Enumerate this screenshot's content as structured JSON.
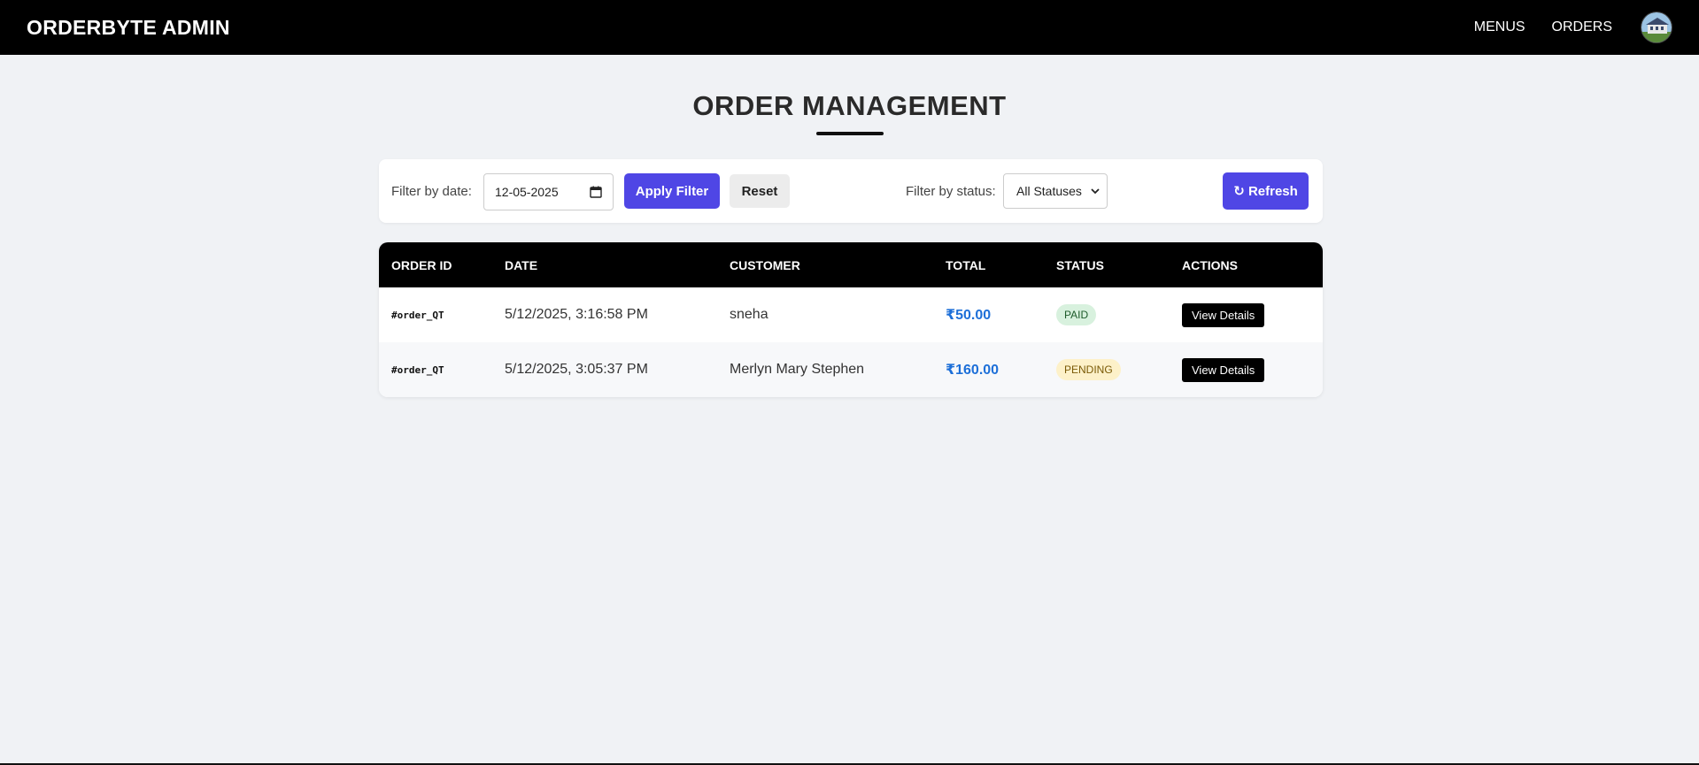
{
  "header": {
    "brand": "ORDERBYTE ADMIN",
    "nav": [
      {
        "label": "MENUS"
      },
      {
        "label": "ORDERS"
      }
    ],
    "avatar_icon": "avatar-image"
  },
  "page": {
    "title": "ORDER MANAGEMENT"
  },
  "filters": {
    "date_label": "Filter by date:",
    "date_value": "12-05-2025",
    "apply_label": "Apply Filter",
    "reset_label": "Reset",
    "status_label": "Filter by status:",
    "status_selected": "All Statuses",
    "refresh_label": "↻ Refresh"
  },
  "table": {
    "columns": [
      "ORDER ID",
      "DATE",
      "CUSTOMER",
      "TOTAL",
      "STATUS",
      "ACTIONS"
    ],
    "rows": [
      {
        "order_id": "#order_QT",
        "date": "5/12/2025, 3:16:58 PM",
        "customer": "sneha",
        "total": "₹50.00",
        "status": "PAID",
        "action": "View Details"
      },
      {
        "order_id": "#order_QT",
        "date": "5/12/2025, 3:05:37 PM",
        "customer": "Merlyn Mary Stephen",
        "total": "₹160.00",
        "status": "PENDING",
        "action": "View Details"
      }
    ]
  },
  "colors": {
    "accent": "#4f46e5",
    "header_bg": "#000000",
    "total_text": "#1d6fd8",
    "paid_badge": "#d8f1de",
    "pending_badge": "#fdf1c9"
  }
}
